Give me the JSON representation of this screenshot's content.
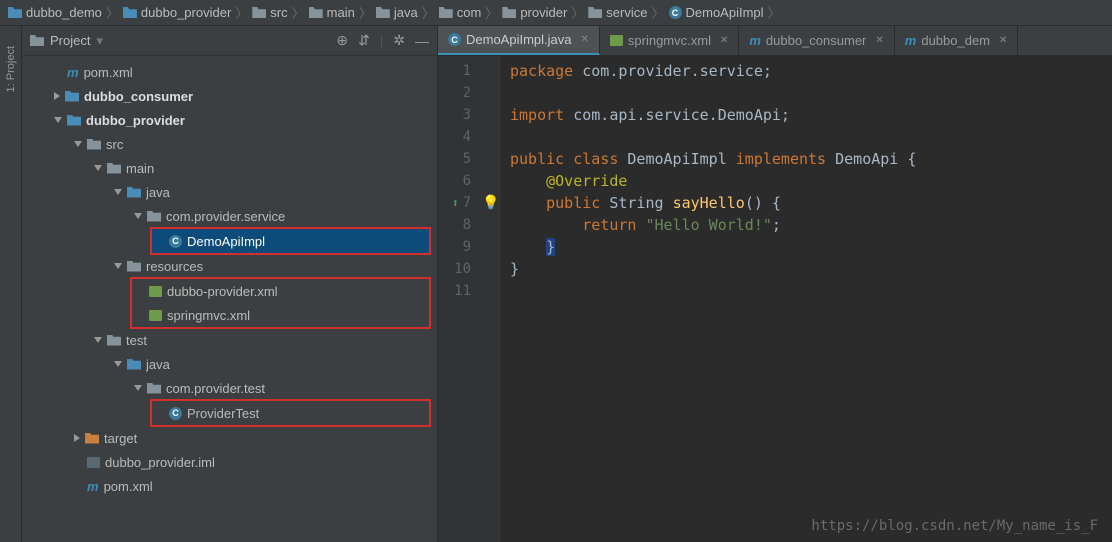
{
  "breadcrumbs": [
    {
      "icon": "folder-blue",
      "label": "dubbo_demo"
    },
    {
      "icon": "folder-blue",
      "label": "dubbo_provider"
    },
    {
      "icon": "folder",
      "label": "src"
    },
    {
      "icon": "folder",
      "label": "main"
    },
    {
      "icon": "folder",
      "label": "java"
    },
    {
      "icon": "folder",
      "label": "com"
    },
    {
      "icon": "folder",
      "label": "provider"
    },
    {
      "icon": "folder",
      "label": "service"
    },
    {
      "icon": "class",
      "label": "DemoApiImpl"
    }
  ],
  "sidebar": {
    "gutter_label": "1: Project",
    "title": "Project",
    "tree": [
      {
        "indent": 0,
        "arrow": "none",
        "icon": "m",
        "label": "pom.xml"
      },
      {
        "indent": 0,
        "arrow": "right",
        "icon": "folder-blue",
        "label": "dubbo_consumer",
        "bold": true
      },
      {
        "indent": 0,
        "arrow": "down",
        "icon": "folder-blue",
        "label": "dubbo_provider",
        "bold": true
      },
      {
        "indent": 1,
        "arrow": "down",
        "icon": "folder",
        "label": "src"
      },
      {
        "indent": 2,
        "arrow": "down",
        "icon": "folder",
        "label": "main"
      },
      {
        "indent": 3,
        "arrow": "down",
        "icon": "folder-blue",
        "label": "java"
      },
      {
        "indent": 4,
        "arrow": "down",
        "icon": "folder",
        "label": "com.provider.service"
      },
      {
        "indent": 5,
        "arrow": "none",
        "icon": "class",
        "label": "DemoApiImpl",
        "selected": true,
        "boxed": true
      },
      {
        "indent": 3,
        "arrow": "down",
        "icon": "folder",
        "label": "resources"
      },
      {
        "indent": 4,
        "arrow": "none",
        "icon": "xml",
        "label": "dubbo-provider.xml",
        "boxgroup": "g1"
      },
      {
        "indent": 4,
        "arrow": "none",
        "icon": "xml",
        "label": "springmvc.xml",
        "boxgroup": "g1"
      },
      {
        "indent": 2,
        "arrow": "down",
        "icon": "folder",
        "label": "test"
      },
      {
        "indent": 3,
        "arrow": "down",
        "icon": "folder-blue",
        "label": "java"
      },
      {
        "indent": 4,
        "arrow": "down",
        "icon": "folder",
        "label": "com.provider.test"
      },
      {
        "indent": 5,
        "arrow": "none",
        "icon": "class",
        "label": "ProviderTest",
        "boxed": true
      },
      {
        "indent": 1,
        "arrow": "right",
        "icon": "folder-orange",
        "label": "target"
      },
      {
        "indent": 1,
        "arrow": "none",
        "icon": "iml",
        "label": "dubbo_provider.iml"
      },
      {
        "indent": 1,
        "arrow": "none",
        "icon": "m",
        "label": "pom.xml"
      }
    ]
  },
  "tabs": [
    {
      "icon": "class",
      "label": "DemoApiImpl.java",
      "active": true
    },
    {
      "icon": "xml",
      "label": "springmvc.xml"
    },
    {
      "icon": "m",
      "label": "dubbo_consumer"
    },
    {
      "icon": "m",
      "label": "dubbo_dem"
    }
  ],
  "code": {
    "lines": [
      {
        "n": 1,
        "t": [
          {
            "c": "kw",
            "s": "package "
          },
          {
            "c": "",
            "s": "com.provider.service;"
          }
        ]
      },
      {
        "n": 2,
        "t": []
      },
      {
        "n": 3,
        "t": [
          {
            "c": "kw",
            "s": "import "
          },
          {
            "c": "",
            "s": "com.api.service.DemoApi;"
          }
        ]
      },
      {
        "n": 4,
        "t": []
      },
      {
        "n": 5,
        "t": [
          {
            "c": "kw",
            "s": "public class "
          },
          {
            "c": "typ",
            "s": "DemoApiImpl "
          },
          {
            "c": "kw",
            "s": "implements "
          },
          {
            "c": "typ",
            "s": "DemoApi {"
          }
        ]
      },
      {
        "n": 6,
        "t": [
          {
            "c": "",
            "s": "    "
          },
          {
            "c": "ann",
            "s": "@Override"
          }
        ]
      },
      {
        "n": 7,
        "t": [
          {
            "c": "",
            "s": "    "
          },
          {
            "c": "kw",
            "s": "public "
          },
          {
            "c": "typ",
            "s": "String "
          },
          {
            "c": "id",
            "s": "sayHello"
          },
          {
            "c": "",
            "s": "() {"
          }
        ],
        "marks": [
          "green-up",
          "bulb"
        ]
      },
      {
        "n": 8,
        "t": [
          {
            "c": "",
            "s": "        "
          },
          {
            "c": "kw",
            "s": "return "
          },
          {
            "c": "str",
            "s": "\"Hello World!\""
          },
          {
            "c": "",
            "s": ";"
          }
        ]
      },
      {
        "n": 9,
        "t": [
          {
            "c": "",
            "s": "    "
          },
          {
            "c": "caret",
            "s": "}"
          }
        ]
      },
      {
        "n": 10,
        "t": [
          {
            "c": "",
            "s": "}"
          }
        ]
      },
      {
        "n": 11,
        "t": []
      }
    ]
  },
  "watermark": "https://blog.csdn.net/My_name_is_F"
}
